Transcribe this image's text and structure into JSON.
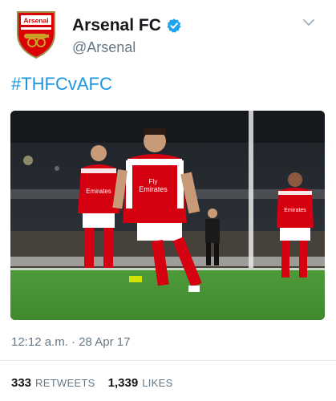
{
  "tweet": {
    "author": {
      "display_name": "Arsenal FC",
      "handle": "@Arsenal",
      "verified": true,
      "avatar_crest_text": "Arsenal"
    },
    "hashtag": "#THFCvAFC",
    "timestamp": "12:12 a.m. · 28 Apr 17",
    "stats": {
      "retweets_count": "333",
      "retweets_label": "RETWEETS",
      "likes_count": "1,339",
      "likes_label": "LIKES"
    },
    "media": {
      "shirt_sponsor_text_1": "Fly",
      "shirt_sponsor_text_2": "Emirates"
    }
  },
  "colors": {
    "link_blue": "#1b95e0",
    "arsenal_red": "#db0007",
    "text_secondary": "#657786",
    "verified_blue": "#1da1f2"
  },
  "icons": {
    "menu": "chevron-down-icon",
    "verified": "verified-badge-icon"
  }
}
